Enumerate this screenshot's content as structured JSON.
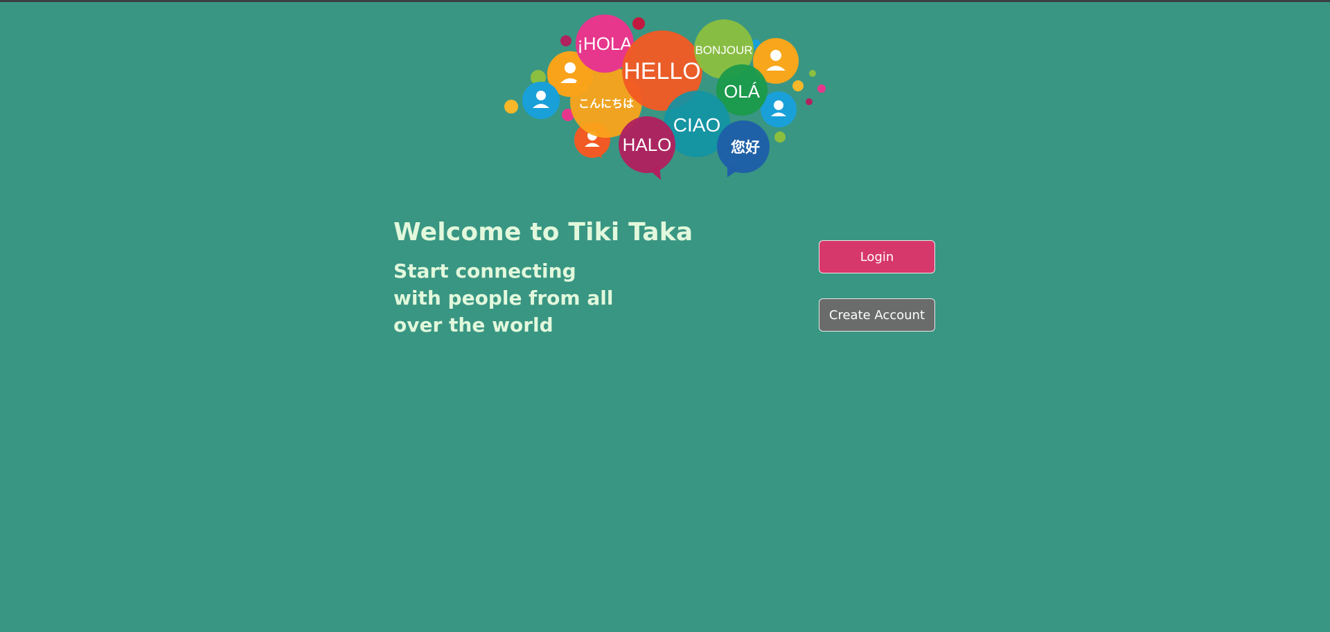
{
  "app": {
    "title": "Tiki Taka"
  },
  "logo": {
    "greetings": [
      "¡HOLA",
      "HELLO",
      "BONJOUR",
      "こんにちは",
      "OLÁ",
      "CIAO",
      "HALO",
      "您好"
    ],
    "colors": {
      "hola": "#e7378d",
      "hello": "#f26a21",
      "bonjour": "#8cbf3f",
      "konnichiwa": "#f9a31b",
      "ola": "#1a9a4b",
      "ciao": "#1294a5",
      "halo": "#b0215f",
      "nihao": "#1e5fa8",
      "user_blue": "#1aa0d9",
      "user_orange": "#f8a61b"
    }
  },
  "hero": {
    "title": "Welcome to Tiki Taka",
    "tagline": "Start connecting with people from all over the world"
  },
  "actions": {
    "login_label": "Login",
    "create_label": "Create Account"
  },
  "colors": {
    "background": "#399683",
    "login": "#d7386b",
    "create": "#6a6b6b",
    "text": "#e2f8dc"
  }
}
